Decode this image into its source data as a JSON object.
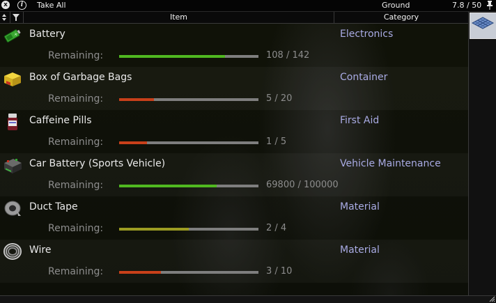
{
  "titlebar": {
    "take_all": "Take All",
    "container_name": "Ground",
    "weight": "7.8 / 50",
    "close_glyph": "x",
    "info_glyph": "i"
  },
  "header": {
    "item": "Item",
    "category": "Category"
  },
  "items": [
    {
      "name": "Battery",
      "category": "Electronics",
      "remaining_label": "Remaining:",
      "remaining": "108 / 142",
      "fraction": 0.76,
      "bar_color": "#50b820",
      "icon": "battery-icon"
    },
    {
      "name": "Box of Garbage Bags",
      "category": "Container",
      "remaining_label": "Remaining:",
      "remaining": "5 / 20",
      "fraction": 0.25,
      "bar_color": "#c8401a",
      "icon": "garbage-bags-box-icon"
    },
    {
      "name": "Caffeine Pills",
      "category": "First Aid",
      "remaining_label": "Remaining:",
      "remaining": "1 / 5",
      "fraction": 0.2,
      "bar_color": "#c8401a",
      "icon": "pill-bottle-icon"
    },
    {
      "name": "Car Battery (Sports Vehicle)",
      "category": "Vehicle Maintenance",
      "remaining_label": "Remaining:",
      "remaining": "69800 / 100000",
      "fraction": 0.698,
      "bar_color": "#50b820",
      "icon": "car-battery-icon"
    },
    {
      "name": "Duct Tape",
      "category": "Material",
      "remaining_label": "Remaining:",
      "remaining": "2 / 4",
      "fraction": 0.5,
      "bar_color": "#9c9c22",
      "icon": "duct-tape-icon"
    },
    {
      "name": "Wire",
      "category": "Material",
      "remaining_label": "Remaining:",
      "remaining": "3 / 10",
      "fraction": 0.3,
      "bar_color": "#c8401a",
      "icon": "wire-coil-icon"
    }
  ],
  "colors": {
    "category_text": "#a9abe4",
    "bar_good": "#50b820",
    "bar_mid": "#9c9c22",
    "bar_low": "#c8401a",
    "bar_track": "#7e7e7e"
  }
}
